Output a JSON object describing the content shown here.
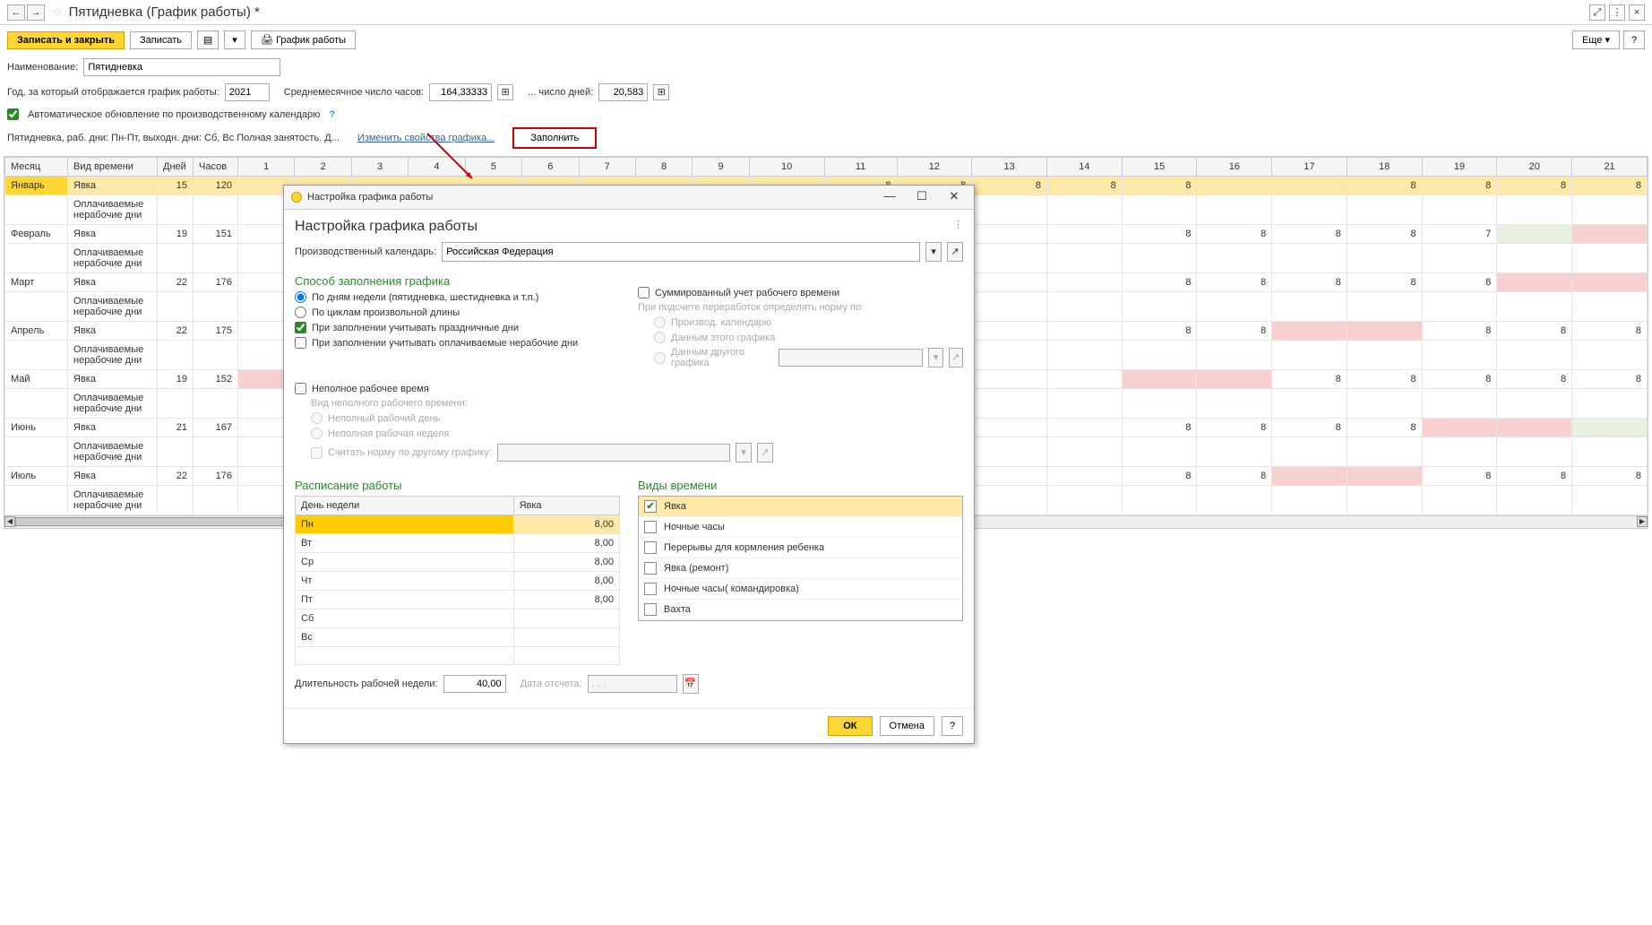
{
  "header": {
    "title": "Пятидневка (График работы) *",
    "nav_back": "←",
    "nav_fwd": "→",
    "star": "☆",
    "expand": "⤢",
    "menu": "⋮",
    "close": "×"
  },
  "toolbar": {
    "save_close": "Записать и закрыть",
    "save": "Записать",
    "icon_list": "▤",
    "icon_folder": "▾",
    "print": "🖨 График работы",
    "more": "Еще ▾",
    "help": "?"
  },
  "form": {
    "name_label": "Наименование:",
    "name_value": "Пятидневка",
    "year_label": "Год, за который отображается график работы:",
    "year_value": "2021",
    "avg_hours_label": "Среднемесячное число часов:",
    "avg_hours_value": "164,33333",
    "avg_days_label": "... число дней:",
    "avg_days_value": "20,583",
    "auto_update": "Автоматическое обновление по производственному календарю",
    "summary": "Пятидневка, раб. дни: Пн-Пт, выходн. дни: Сб, Вс Полная занятость. Д...",
    "change_link": "Изменить свойства графика...",
    "fill_btn": "Заполнить"
  },
  "table": {
    "headers": [
      "Месяц",
      "Вид времени",
      "Дней",
      "Часов",
      "1",
      "2",
      "3",
      "4",
      "5",
      "6",
      "7",
      "8",
      "9",
      "10",
      "11",
      "12",
      "13",
      "14",
      "15",
      "16",
      "17",
      "18",
      "19",
      "20",
      "21"
    ],
    "rows": [
      {
        "month": "Январь",
        "type": "Явка",
        "days": "15",
        "hours": "120",
        "sel": true,
        "cells": [
          "",
          "",
          "",
          "",
          "",
          "",
          "",
          "",
          "",
          "",
          "8",
          "8",
          "8",
          "8",
          "8",
          "",
          "",
          "8",
          "8",
          "8",
          "8"
        ],
        "pink": [
          0,
          1,
          2,
          3,
          4,
          5,
          6,
          7,
          8,
          9,
          15,
          16
        ],
        "green": []
      },
      {
        "month": "",
        "type": "Оплачиваемые нерабочие дни",
        "days": "",
        "hours": "",
        "cells": [
          "",
          "",
          "",
          "",
          "",
          "",
          "",
          "",
          "",
          "",
          "",
          "",
          "",
          "",
          "",
          "",
          "",
          "",
          "",
          "",
          ""
        ],
        "pink": [],
        "green": []
      },
      {
        "month": "Февраль",
        "type": "Явка",
        "days": "19",
        "hours": "151",
        "cells": [
          "",
          "",
          "",
          "",
          "",
          "",
          "",
          "",
          "",
          "",
          "",
          "",
          "",
          "",
          "8",
          "8",
          "8",
          "8",
          "7",
          "",
          ""
        ],
        "pink": [
          20
        ],
        "green": [
          19
        ]
      },
      {
        "month": "",
        "type": "Оплачиваемые нерабочие дни",
        "days": "",
        "hours": "",
        "cells": [
          "",
          "",
          "",
          "",
          "",
          "",
          "",
          "",
          "",
          "",
          "",
          "",
          "",
          "",
          "",
          "",
          "",
          "",
          "",
          "",
          ""
        ],
        "pink": [],
        "green": []
      },
      {
        "month": "Март",
        "type": "Явка",
        "days": "22",
        "hours": "176",
        "cells": [
          "",
          "",
          "",
          "",
          "",
          "",
          "",
          "",
          "",
          "",
          "",
          "",
          "",
          "",
          "8",
          "8",
          "8",
          "8",
          "8",
          "",
          ""
        ],
        "pink": [
          19,
          20
        ],
        "green": []
      },
      {
        "month": "",
        "type": "Оплачиваемые нерабочие дни",
        "days": "",
        "hours": "",
        "cells": [
          "",
          "",
          "",
          "",
          "",
          "",
          "",
          "",
          "",
          "",
          "",
          "",
          "",
          "",
          "",
          "",
          "",
          "",
          "",
          "",
          ""
        ],
        "pink": [],
        "green": []
      },
      {
        "month": "Апрель",
        "type": "Явка",
        "days": "22",
        "hours": "175",
        "cells": [
          "",
          "",
          "",
          "",
          "",
          "",
          "",
          "",
          "",
          "",
          "",
          "",
          "",
          "",
          "8",
          "8",
          "",
          "",
          "8",
          "8",
          "8"
        ],
        "pink": [
          16,
          17
        ],
        "green": []
      },
      {
        "month": "",
        "type": "Оплачиваемые нерабочие дни",
        "days": "",
        "hours": "",
        "cells": [
          "",
          "",
          "",
          "",
          "",
          "",
          "",
          "",
          "",
          "",
          "",
          "",
          "",
          "",
          "",
          "",
          "",
          "",
          "",
          "",
          ""
        ],
        "pink": [],
        "green": []
      },
      {
        "month": "Май",
        "type": "Явка",
        "days": "19",
        "hours": "152",
        "cells": [
          "",
          "",
          "",
          "",
          "",
          "",
          "",
          "",
          "",
          "",
          "",
          "",
          "",
          "",
          "",
          "",
          "8",
          "8",
          "8",
          "8",
          "8"
        ],
        "pink": [
          0,
          14,
          15
        ],
        "green": []
      },
      {
        "month": "",
        "type": "Оплачиваемые нерабочие дни",
        "days": "",
        "hours": "",
        "cells": [
          "",
          "",
          "",
          "",
          "",
          "",
          "",
          "",
          "",
          "",
          "",
          "",
          "",
          "",
          "",
          "",
          "",
          "",
          "",
          "",
          ""
        ],
        "pink": [],
        "green": []
      },
      {
        "month": "Июнь",
        "type": "Явка",
        "days": "21",
        "hours": "167",
        "cells": [
          "",
          "",
          "",
          "",
          "",
          "",
          "",
          "",
          "",
          "",
          "",
          "",
          "",
          "",
          "8",
          "8",
          "8",
          "8",
          "",
          "",
          ""
        ],
        "pink": [
          18,
          19
        ],
        "green": [
          20
        ]
      },
      {
        "month": "",
        "type": "Оплачиваемые нерабочие дни",
        "days": "",
        "hours": "",
        "cells": [
          "",
          "",
          "",
          "",
          "",
          "",
          "",
          "",
          "",
          "",
          "",
          "",
          "",
          "",
          "",
          "",
          "",
          "",
          "",
          "",
          ""
        ],
        "pink": [],
        "green": []
      },
      {
        "month": "Июль",
        "type": "Явка",
        "days": "22",
        "hours": "176",
        "cells": [
          "",
          "",
          "",
          "",
          "",
          "",
          "",
          "",
          "",
          "",
          "",
          "",
          "",
          "",
          "8",
          "8",
          "",
          "",
          "8",
          "8",
          "8"
        ],
        "pink": [
          16,
          17
        ],
        "green": []
      },
      {
        "month": "",
        "type": "Оплачиваемые нерабочие дни",
        "days": "",
        "hours": "",
        "cells": [
          "",
          "",
          "",
          "",
          "",
          "",
          "",
          "",
          "",
          "",
          "",
          "",
          "",
          "",
          "",
          "",
          "",
          "",
          "",
          "",
          ""
        ],
        "pink": [],
        "green": []
      }
    ]
  },
  "dialog": {
    "titlebar": "Настройка графика работы",
    "heading": "Настройка графика работы",
    "more": "⋮",
    "calendar_label": "Производственный календарь:",
    "calendar_value": "Российская Федерация",
    "method_title": "Способ заполнения графика",
    "radio_weekly": "По дням недели (пятидневка, шестидневка и т.п.)",
    "radio_cycle": "По циклам произвольной длины",
    "check_holidays": "При заполнении учитывать праздничные дни",
    "check_paid": "При заполнении учитывать оплачиваемые нерабочие дни",
    "check_summed": "Суммированный учет рабочего времени",
    "norm_label": "При подсчете переработок определять норму по:",
    "norm_calendar": "Производ. календарю",
    "norm_this": "Данным этого графика",
    "norm_other": "Данным другого графика",
    "check_parttime": "Неполное рабочее время",
    "parttime_kind": "Вид неполного рабочего времени:",
    "parttime_day": "Неполный рабочий день",
    "parttime_week": "Неполная рабочая неделя",
    "norm_other_sched": "Считать норму по другому графику:",
    "schedule_title": "Расписание работы",
    "sched_h1": "День недели",
    "sched_h2": "Явка",
    "sched_rows": [
      {
        "day": "Пн",
        "hours": "8,00",
        "sel": true
      },
      {
        "day": "Вт",
        "hours": "8,00"
      },
      {
        "day": "Ср",
        "hours": "8,00"
      },
      {
        "day": "Чт",
        "hours": "8,00"
      },
      {
        "day": "Пт",
        "hours": "8,00"
      },
      {
        "day": "Сб",
        "hours": ""
      },
      {
        "day": "Вс",
        "hours": ""
      }
    ],
    "types_title": "Виды времени",
    "types": [
      {
        "name": "Явка",
        "checked": true,
        "sel": true
      },
      {
        "name": "Ночные часы"
      },
      {
        "name": "Перерывы для кормления ребенка"
      },
      {
        "name": "Явка (ремонт)"
      },
      {
        "name": "Ночные часы( командировка)"
      },
      {
        "name": "Вахта"
      }
    ],
    "week_len_label": "Длительность рабочей недели:",
    "week_len_value": "40,00",
    "start_date_label": "Дата отсчета:",
    "start_date_value": ". . .",
    "ok": "ОК",
    "cancel": "Отмена",
    "help": "?"
  }
}
